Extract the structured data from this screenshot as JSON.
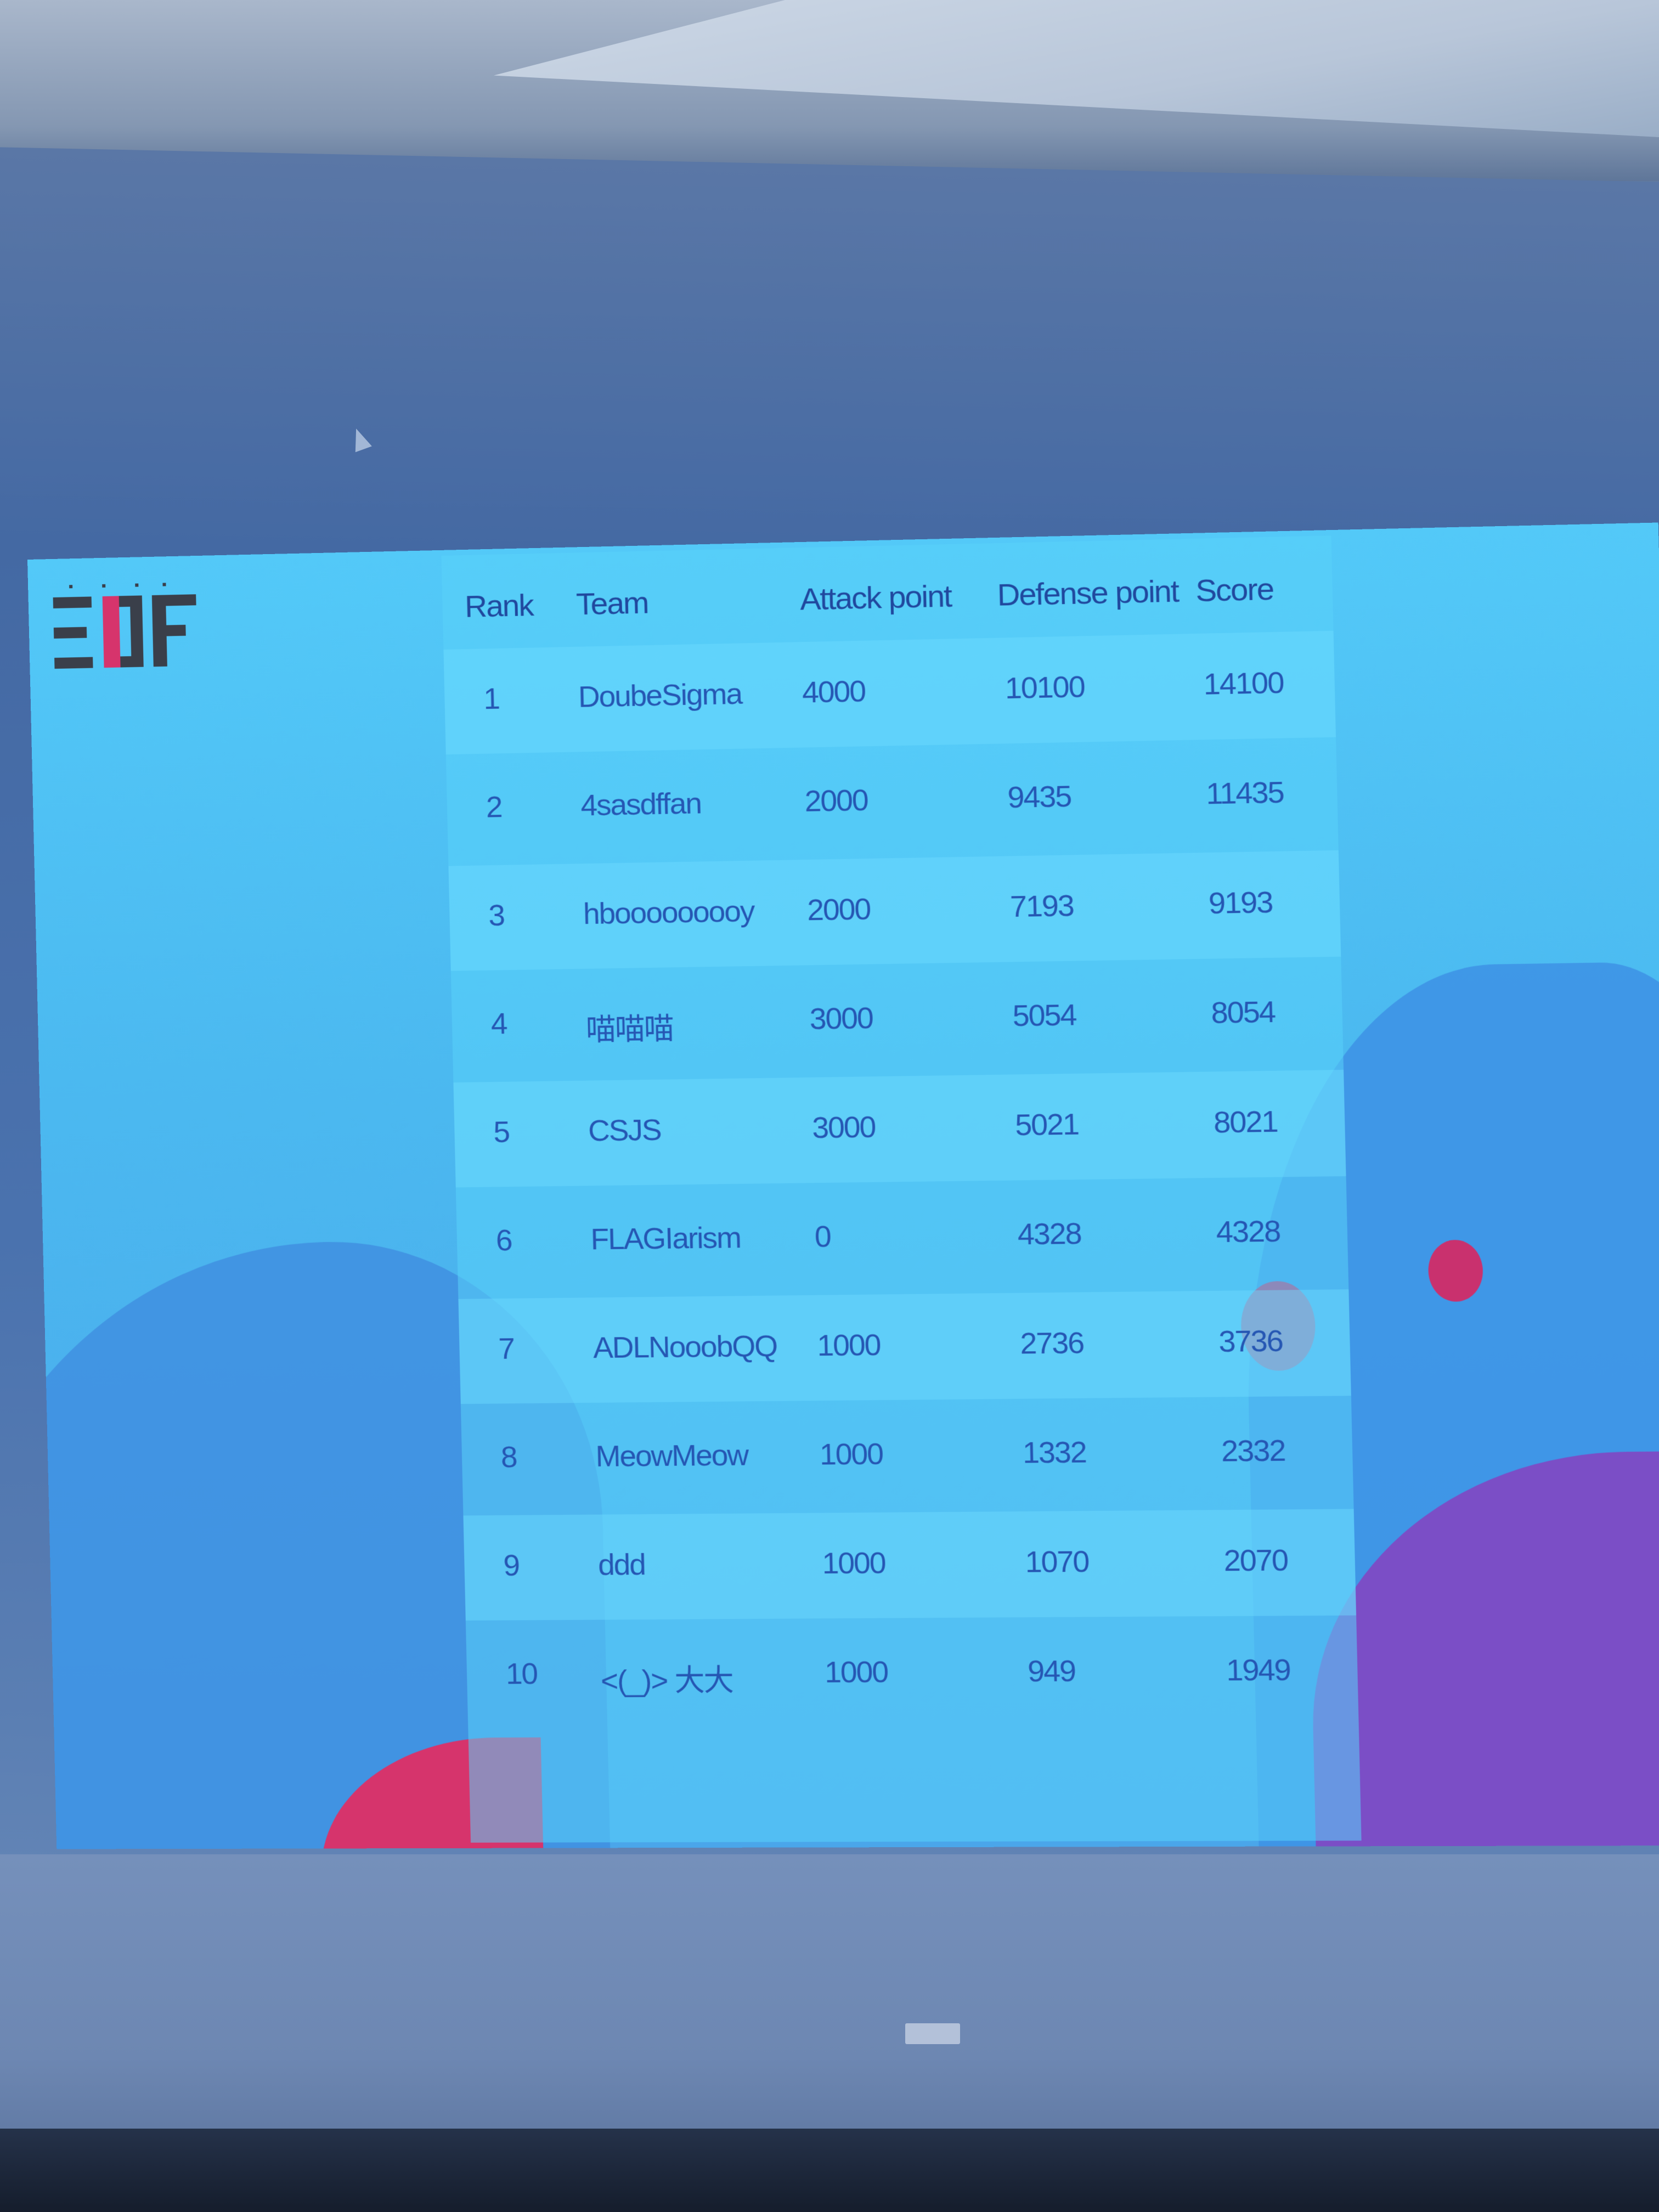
{
  "logo": {
    "text": "EOF"
  },
  "table": {
    "headers": {
      "rank": "Rank",
      "team": "Team",
      "attack": "Attack point",
      "defense": "Defense point",
      "score": "Score"
    },
    "rows": [
      {
        "rank": "1",
        "team": "DoubeSigma",
        "attack": "4000",
        "defense": "10100",
        "score": "14100"
      },
      {
        "rank": "2",
        "team": "4sasdffan",
        "attack": "2000",
        "defense": "9435",
        "score": "11435"
      },
      {
        "rank": "3",
        "team": "hbooooooooy",
        "attack": "2000",
        "defense": "7193",
        "score": "9193"
      },
      {
        "rank": "4",
        "team": "喵喵喵",
        "attack": "3000",
        "defense": "5054",
        "score": "8054"
      },
      {
        "rank": "5",
        "team": "CSJS",
        "attack": "3000",
        "defense": "5021",
        "score": "8021"
      },
      {
        "rank": "6",
        "team": "FLAGIarism",
        "attack": "0",
        "defense": "4328",
        "score": "4328"
      },
      {
        "rank": "7",
        "team": "ADLNooobQQ",
        "attack": "1000",
        "defense": "2736",
        "score": "3736"
      },
      {
        "rank": "8",
        "team": "MeowMeow",
        "attack": "1000",
        "defense": "1332",
        "score": "2332"
      },
      {
        "rank": "9",
        "team": "ddd",
        "attack": "1000",
        "defense": "1070",
        "score": "2070"
      },
      {
        "rank": "10",
        "team": "<(_)> 大大",
        "attack": "1000",
        "defense": "949",
        "score": "1949"
      }
    ]
  },
  "colors": {
    "slide_bg": "#53c9f8",
    "text": "#2556b3",
    "accent_magenta": "#c9316e",
    "logo_dark": "#3a3f4a",
    "logo_red": "#d6346c"
  }
}
